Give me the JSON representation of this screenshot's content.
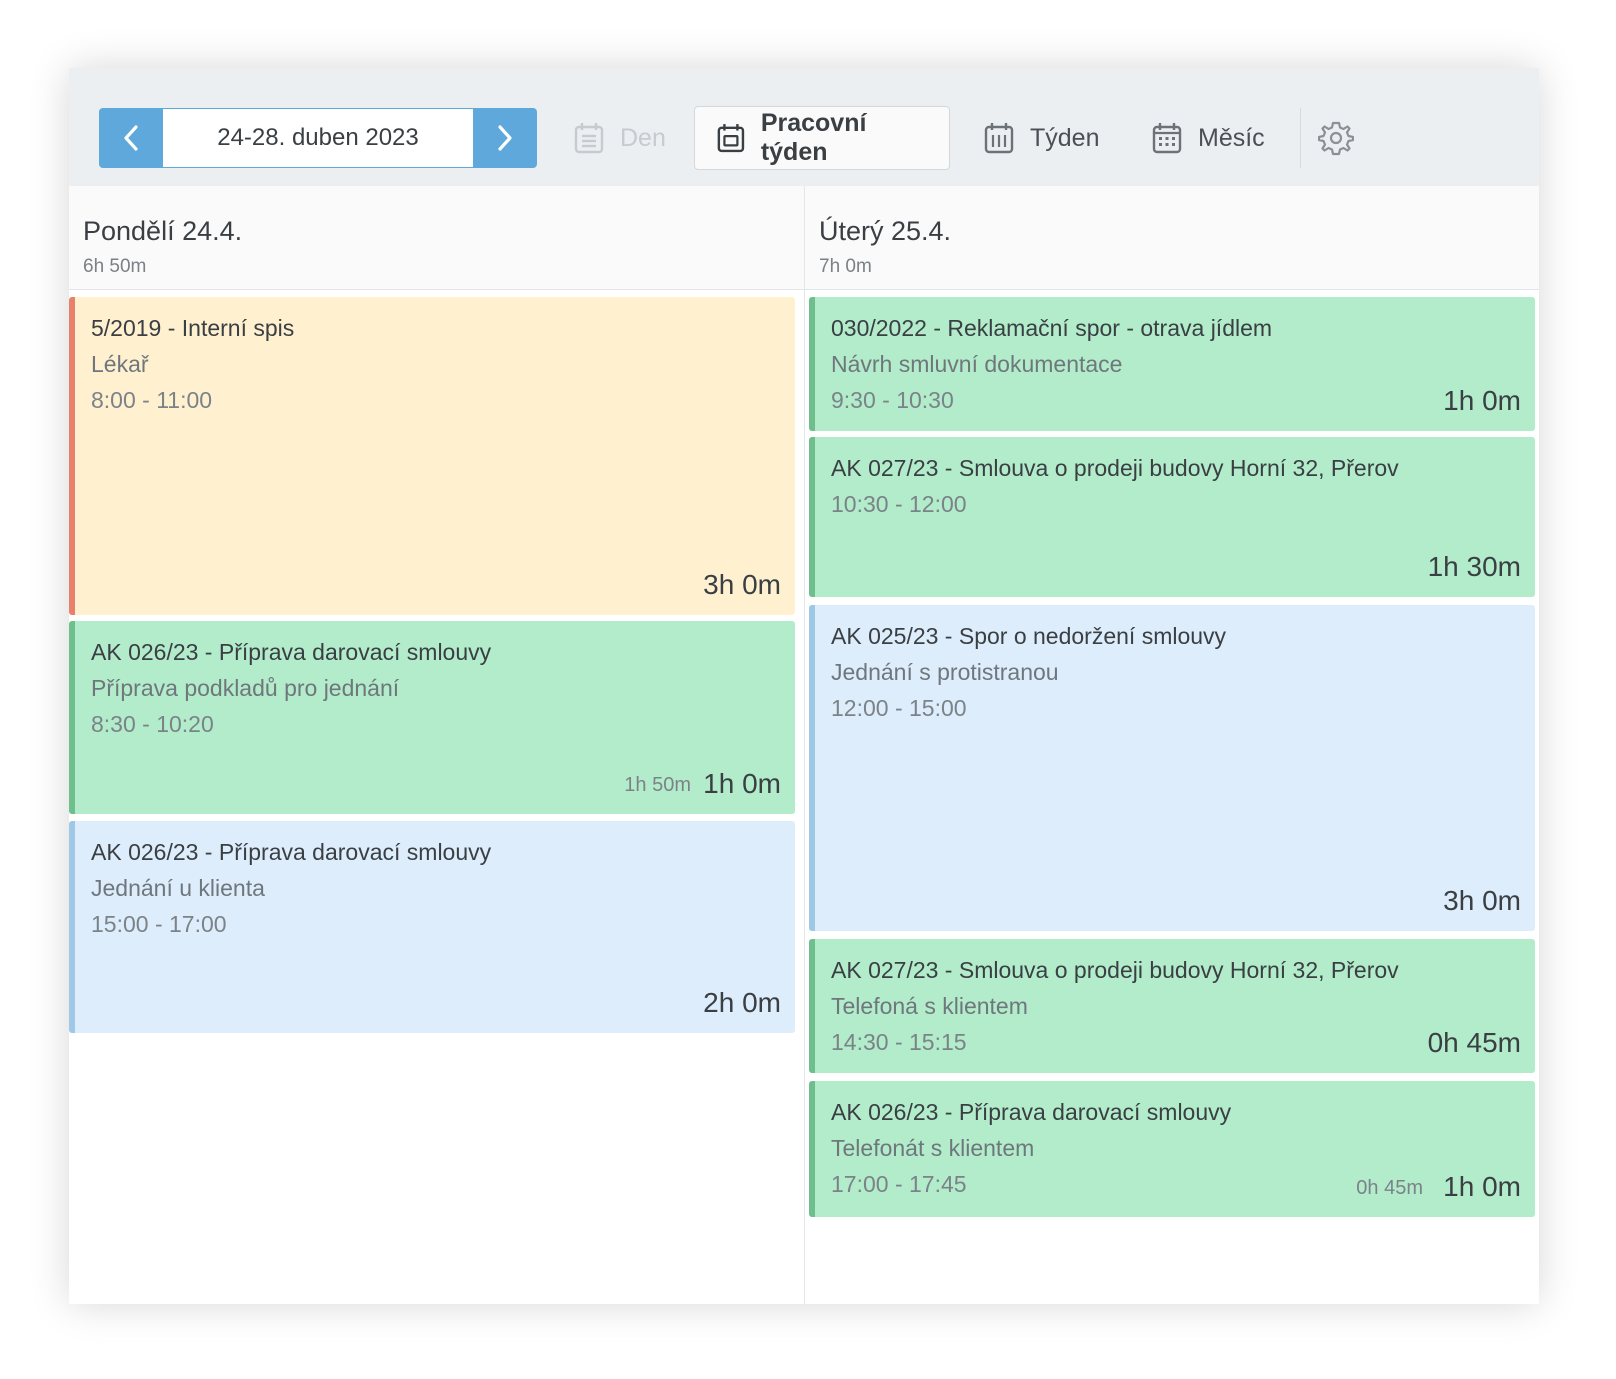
{
  "toolbar": {
    "date_range": "24-28. duben 2023",
    "views": {
      "day": "Den",
      "work_week": "Pracovní týden",
      "week": "Týden",
      "month": "Měsíc"
    },
    "active_view": "work_week",
    "accent_color": "#5fa8dc"
  },
  "days": [
    {
      "title": "Pondělí 24.4.",
      "total": "6h 50m",
      "events": [
        {
          "title": "5/2019 - Interní spis",
          "subtitle": "Lékař",
          "time": "8:00 - 11:00",
          "duration": "3h 0m",
          "color": "yellow"
        },
        {
          "title": "AK 026/23 - Příprava darovací smlouvy",
          "subtitle": "Příprava podkladů pro jednání",
          "time": "8:30 - 10:20",
          "planned": "1h 50m",
          "duration": "1h 0m",
          "color": "green"
        },
        {
          "title": "AK 026/23 - Příprava darovací smlouvy",
          "subtitle": "Jednání u klienta",
          "time": "15:00 - 17:00",
          "duration": "2h 0m",
          "color": "blue"
        }
      ]
    },
    {
      "title": "Úterý 25.4.",
      "total": "7h 0m",
      "events": [
        {
          "title": "030/2022 - Reklamační spor - otrava jídlem",
          "subtitle": "Návrh smluvní dokumentace",
          "time": "9:30 - 10:30",
          "duration": "1h 0m",
          "color": "green"
        },
        {
          "title": "AK 027/23 - Smlouva o prodeji budovy Horní 32, Přerov",
          "time": "10:30 - 12:00",
          "duration": "1h 30m",
          "color": "green"
        },
        {
          "title": "AK 025/23 - Spor o nedoržení smlouvy",
          "subtitle": "Jednání s protistranou",
          "time": "12:00 - 15:00",
          "duration": "3h 0m",
          "color": "blue"
        },
        {
          "title": "AK 027/23 - Smlouva o prodeji budovy Horní 32, Přerov",
          "subtitle": "Telefoná s klientem",
          "time": "14:30 - 15:15",
          "duration": "0h 45m",
          "color": "green"
        },
        {
          "title": "AK 026/23 - Příprava darovací smlouvy",
          "subtitle": "Telefonát s klientem",
          "time": "17:00 - 17:45",
          "planned": "0h 45m",
          "duration": "1h 0m",
          "color": "green"
        }
      ]
    }
  ]
}
